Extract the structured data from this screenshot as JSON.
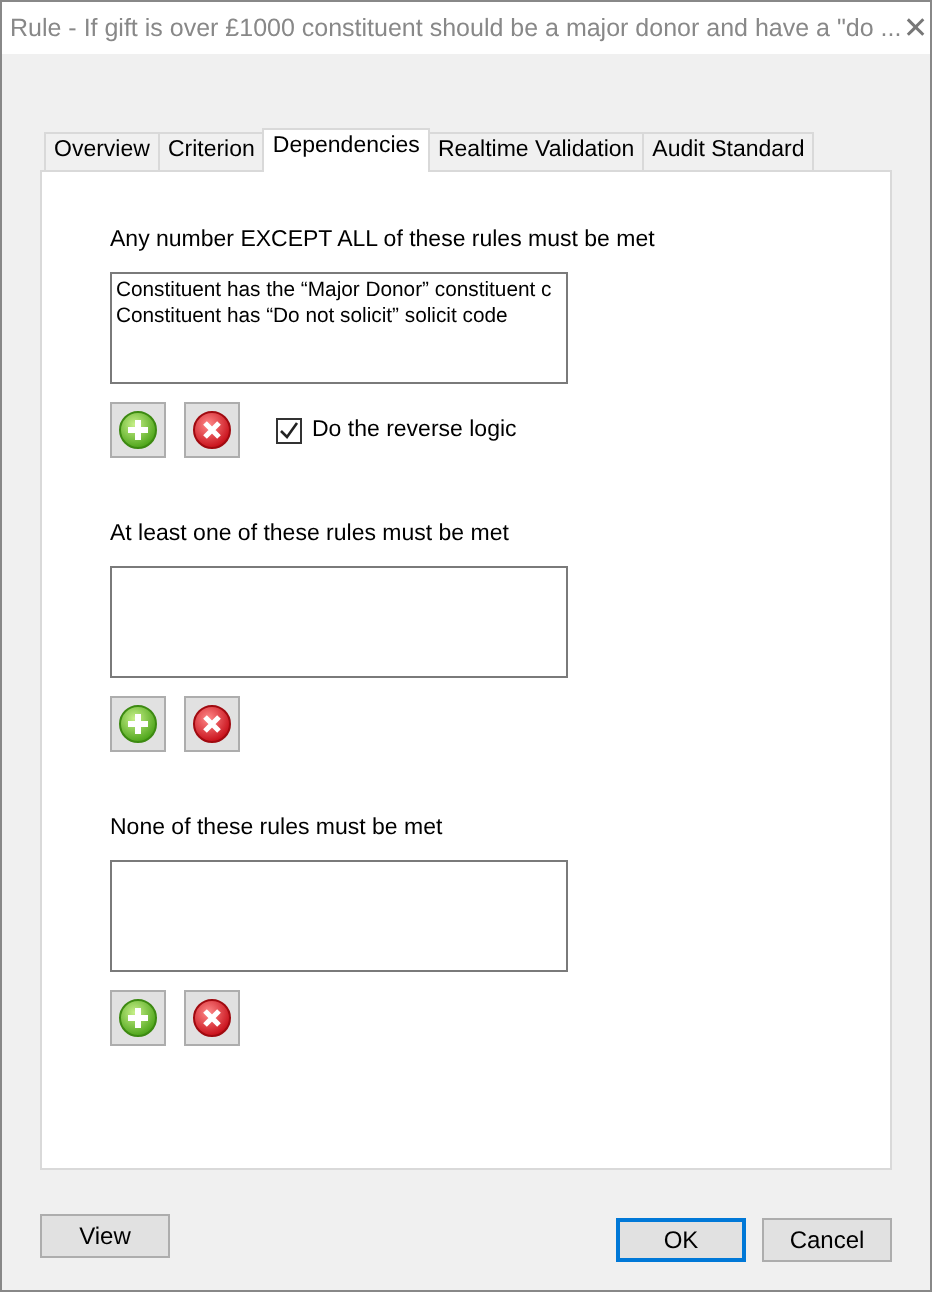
{
  "window": {
    "title": "Rule - If gift is over £1000 constituent should be a major donor and have a  \"do ...",
    "close": "✕"
  },
  "tabs": [
    {
      "label": "Overview",
      "selected": false
    },
    {
      "label": "Criterion",
      "selected": false
    },
    {
      "label": "Dependencies",
      "selected": true
    },
    {
      "label": "Realtime Validation",
      "selected": false
    },
    {
      "label": "Audit Standard",
      "selected": false
    }
  ],
  "sections": [
    {
      "label": "Any number EXCEPT ALL of these rules must be met",
      "items": [
        "Constituent has the “Major Donor” constituent c",
        "Constituent has “Do not solicit” solicit code"
      ],
      "reverse": {
        "label": "Do the reverse logic",
        "checked": true
      }
    },
    {
      "label": "At least one of these rules must be met"
    },
    {
      "label": "None of these rules must be met"
    }
  ],
  "buttons": [
    {
      "label": "View",
      "kind": "left"
    },
    {
      "label": "OK",
      "kind": "default"
    },
    {
      "label": "Cancel",
      "kind": "normal"
    }
  ]
}
